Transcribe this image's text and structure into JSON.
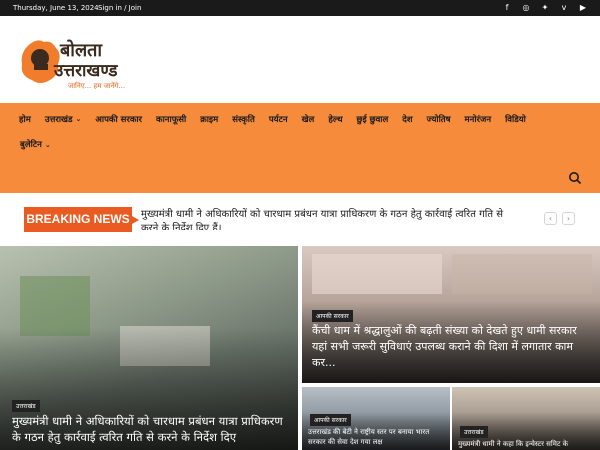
{
  "topbar": {
    "date": "Thursday, June 13, 2024",
    "signin": "Sign in / Join",
    "social": [
      "facebook-icon",
      "instagram-icon",
      "twitter-icon",
      "vimeo-icon",
      "youtube-icon"
    ]
  },
  "logo": {
    "line1": "बोलता",
    "line2": "उत्तराखण्ड",
    "tagline": "जानिए... हम जानेंगे..."
  },
  "nav": {
    "items": [
      {
        "label": "होम"
      },
      {
        "label": "उत्तराखंड"
      },
      {
        "label": "आपकी सरकार"
      },
      {
        "label": "कानाफूसी"
      },
      {
        "label": "क्राइम"
      },
      {
        "label": "संस्कृति"
      },
      {
        "label": "पर्यटन"
      },
      {
        "label": "खेल"
      },
      {
        "label": "हेल्थ"
      },
      {
        "label": "छुई छुवाल"
      },
      {
        "label": "देश"
      },
      {
        "label": "ज्योतिष"
      },
      {
        "label": "मनोरंजन"
      },
      {
        "label": "विडियो"
      }
    ],
    "second_row": [
      {
        "label": "बुलेटिन"
      }
    ]
  },
  "breaking": {
    "label": "BREAKING NEWS",
    "text": "मुख्यमंत्री धामी ने अधिकारियों को चारधाम प्रबंधन यात्रा प्राधिकरण के गठन हेतु कार्रवाई त्वरित गति से करने के निर्देश दिए हैं।"
  },
  "articles": [
    {
      "category": "उत्तराखंड",
      "title": "मुख्यमंत्री धामी ने अधिकारियों को चारधाम प्रबंधन यात्रा प्राधिकरण के गठन हेतु कार्रवाई त्वरित गति से करने के निर्देश दिए"
    },
    {
      "category": "आपकी सरकार",
      "title": "कैंची धाम में श्रद्धालुओं की बढ़ती संख्या को देखते हुए धामी सरकार यहां सभी जरूरी सुविधाएं उपलब्ध कराने की दिशा में लगातार काम कर..."
    },
    {
      "category": "आपकी सरकार",
      "title": "उत्तराखंड की बेटी ने राष्ट्रीय स्तर पर बनाया भारत सरकार की सेवा देश गया लक्ष"
    },
    {
      "category": "उत्तराखंड",
      "title": "मुख्यमंत्री धामी ने कहा कि इन्वेस्टर समिट के"
    }
  ],
  "colors": {
    "accent": "#f58b3b",
    "breaking": "#ea5b22",
    "topbar": "#1a1a1a"
  }
}
